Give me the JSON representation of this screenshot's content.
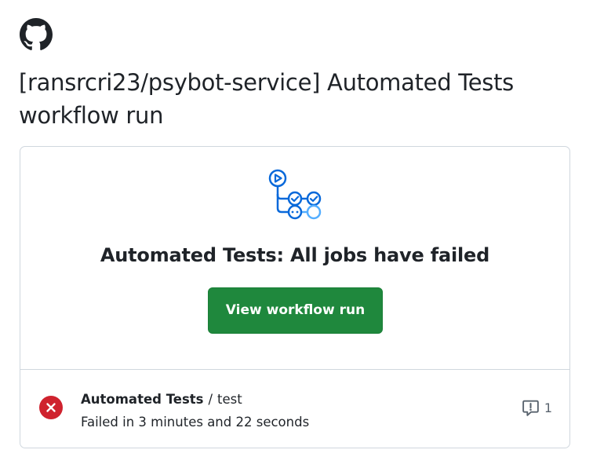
{
  "email": {
    "logo_icon": "github-mark-icon",
    "title": "[ransrcri23/psybot-service] Automated Tests workflow run"
  },
  "card": {
    "workflow_icon": "workflow-graph-icon",
    "headline": "Automated Tests: All jobs have failed",
    "button_label": "View workflow run",
    "job": {
      "status_icon": "x-circle-fill-icon",
      "workflow_name": "Automated Tests",
      "separator": "/",
      "job_name": "test",
      "status_text": "Failed in 3 minutes and 22 seconds",
      "annotation_icon": "comment-alert-icon",
      "annotation_count": "1"
    }
  },
  "colors": {
    "button_bg": "#1f883d",
    "failure_red": "#cf222e",
    "workflow_blue": "#0969da",
    "border": "#d0d7de"
  }
}
